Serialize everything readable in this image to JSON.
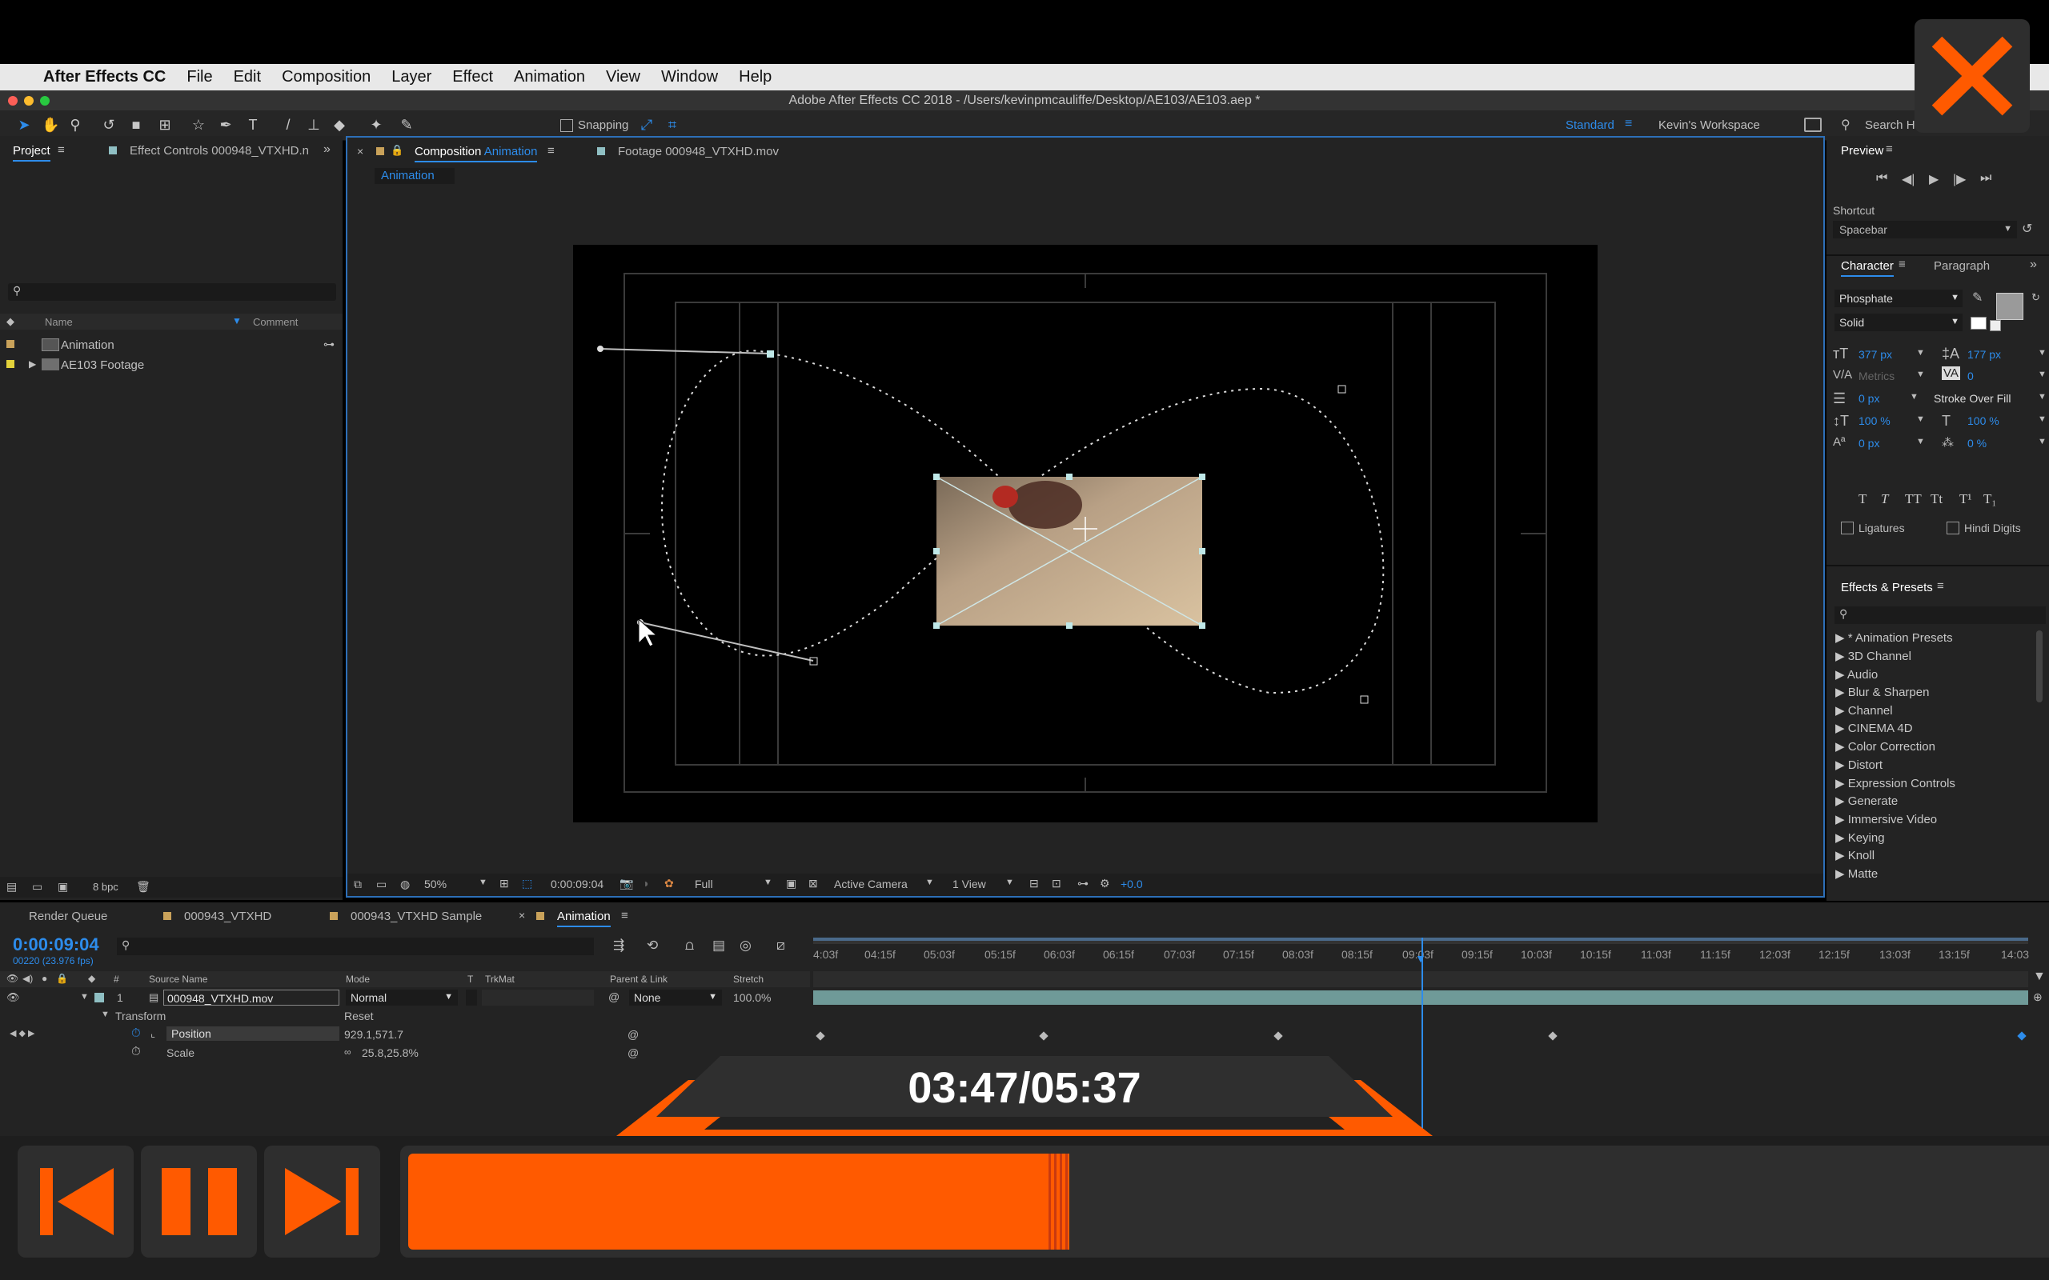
{
  "menubar": {
    "app": "After Effects CC",
    "items": [
      "File",
      "Edit",
      "Composition",
      "Layer",
      "Effect",
      "Animation",
      "View",
      "Window",
      "Help"
    ]
  },
  "window_title": "Adobe After Effects CC 2018 - /Users/kevinpmcauliffe/Desktop/AE103/AE103.aep *",
  "toolbar": {
    "snapping": "Snapping",
    "workspace_active": "Standard",
    "workspace_other": "Kevin's Workspace",
    "search": "Search H"
  },
  "project_panel": {
    "tab_project": "Project",
    "tab_effect_controls": "Effect Controls 000948_VTXHD.n",
    "col_name": "Name",
    "col_comment": "Comment",
    "items": [
      {
        "label": "Animation",
        "color": "#c9a25a"
      },
      {
        "label": "AE103 Footage",
        "color": "#e3d23b"
      }
    ],
    "bpc": "8 bpc"
  },
  "viewer": {
    "tab_composition_prefix": "Composition",
    "tab_composition_name": "Animation",
    "tab_footage": "Footage 000948_VTXHD.mov",
    "subtab": "Animation",
    "zoom": "50%",
    "timecode": "0:00:09:04",
    "resolution": "Full",
    "camera": "Active Camera",
    "views": "1 View",
    "exposure": "+0.0"
  },
  "preview_panel": {
    "title": "Preview",
    "shortcut_label": "Shortcut",
    "shortcut_value": "Spacebar"
  },
  "character_panel": {
    "tab_character": "Character",
    "tab_paragraph": "Paragraph",
    "font": "Phosphate",
    "style": "Solid",
    "font_size": "377 px",
    "leading": "177 px",
    "kerning": "Metrics",
    "tracking": "0",
    "stroke_width": "0 px",
    "stroke_mode": "Stroke Over Fill",
    "vscale": "100 %",
    "hscale": "100 %",
    "baseline": "0 px",
    "tsume": "0 %",
    "ligatures": "Ligatures",
    "hindi": "Hindi Digits",
    "styles": [
      "T",
      "T",
      "TT",
      "Tt",
      "T¹",
      "T₁"
    ]
  },
  "effects_panel": {
    "title": "Effects & Presets",
    "items": [
      "* Animation Presets",
      "3D Channel",
      "Audio",
      "Blur & Sharpen",
      "Channel",
      "CINEMA 4D",
      "Color Correction",
      "Distort",
      "Expression Controls",
      "Generate",
      "Immersive Video",
      "Keying",
      "Knoll",
      "Matte"
    ]
  },
  "timeline": {
    "tabs": [
      "Render Queue",
      "000943_VTXHD",
      "000943_VTXHD Sample",
      "Animation"
    ],
    "timecode": "0:00:09:04",
    "frames": "00220 (23.976 fps)",
    "cols": {
      "source": "Source Name",
      "mode": "Mode",
      "t": "T",
      "trkmat": "TrkMat",
      "parent": "Parent & Link",
      "stretch": "Stretch"
    },
    "layer": {
      "num": "1",
      "name": "000948_VTXHD.mov",
      "mode": "Normal",
      "parent": "None",
      "stretch": "100.0%"
    },
    "transform": "Transform",
    "reset": "Reset",
    "position_label": "Position",
    "position_value": "929.1,571.7",
    "scale_label": "Scale",
    "scale_value": "25.8,25.8%",
    "ticks": [
      "4:03f",
      "04:15f",
      "05:03f",
      "05:15f",
      "06:03f",
      "06:15f",
      "07:03f",
      "07:15f",
      "08:03f",
      "08:15f",
      "09:03f",
      "09:15f",
      "10:03f",
      "10:15f",
      "11:03f",
      "11:15f",
      "12:03f",
      "12:15f",
      "13:03f",
      "13:15f",
      "14:03"
    ]
  },
  "player": {
    "time": "03:47/05:37",
    "progress": 0.675,
    "accent": "#ff5a00",
    "icons": [
      "close-icon",
      "previous-icon",
      "pause-icon",
      "next-icon"
    ]
  }
}
